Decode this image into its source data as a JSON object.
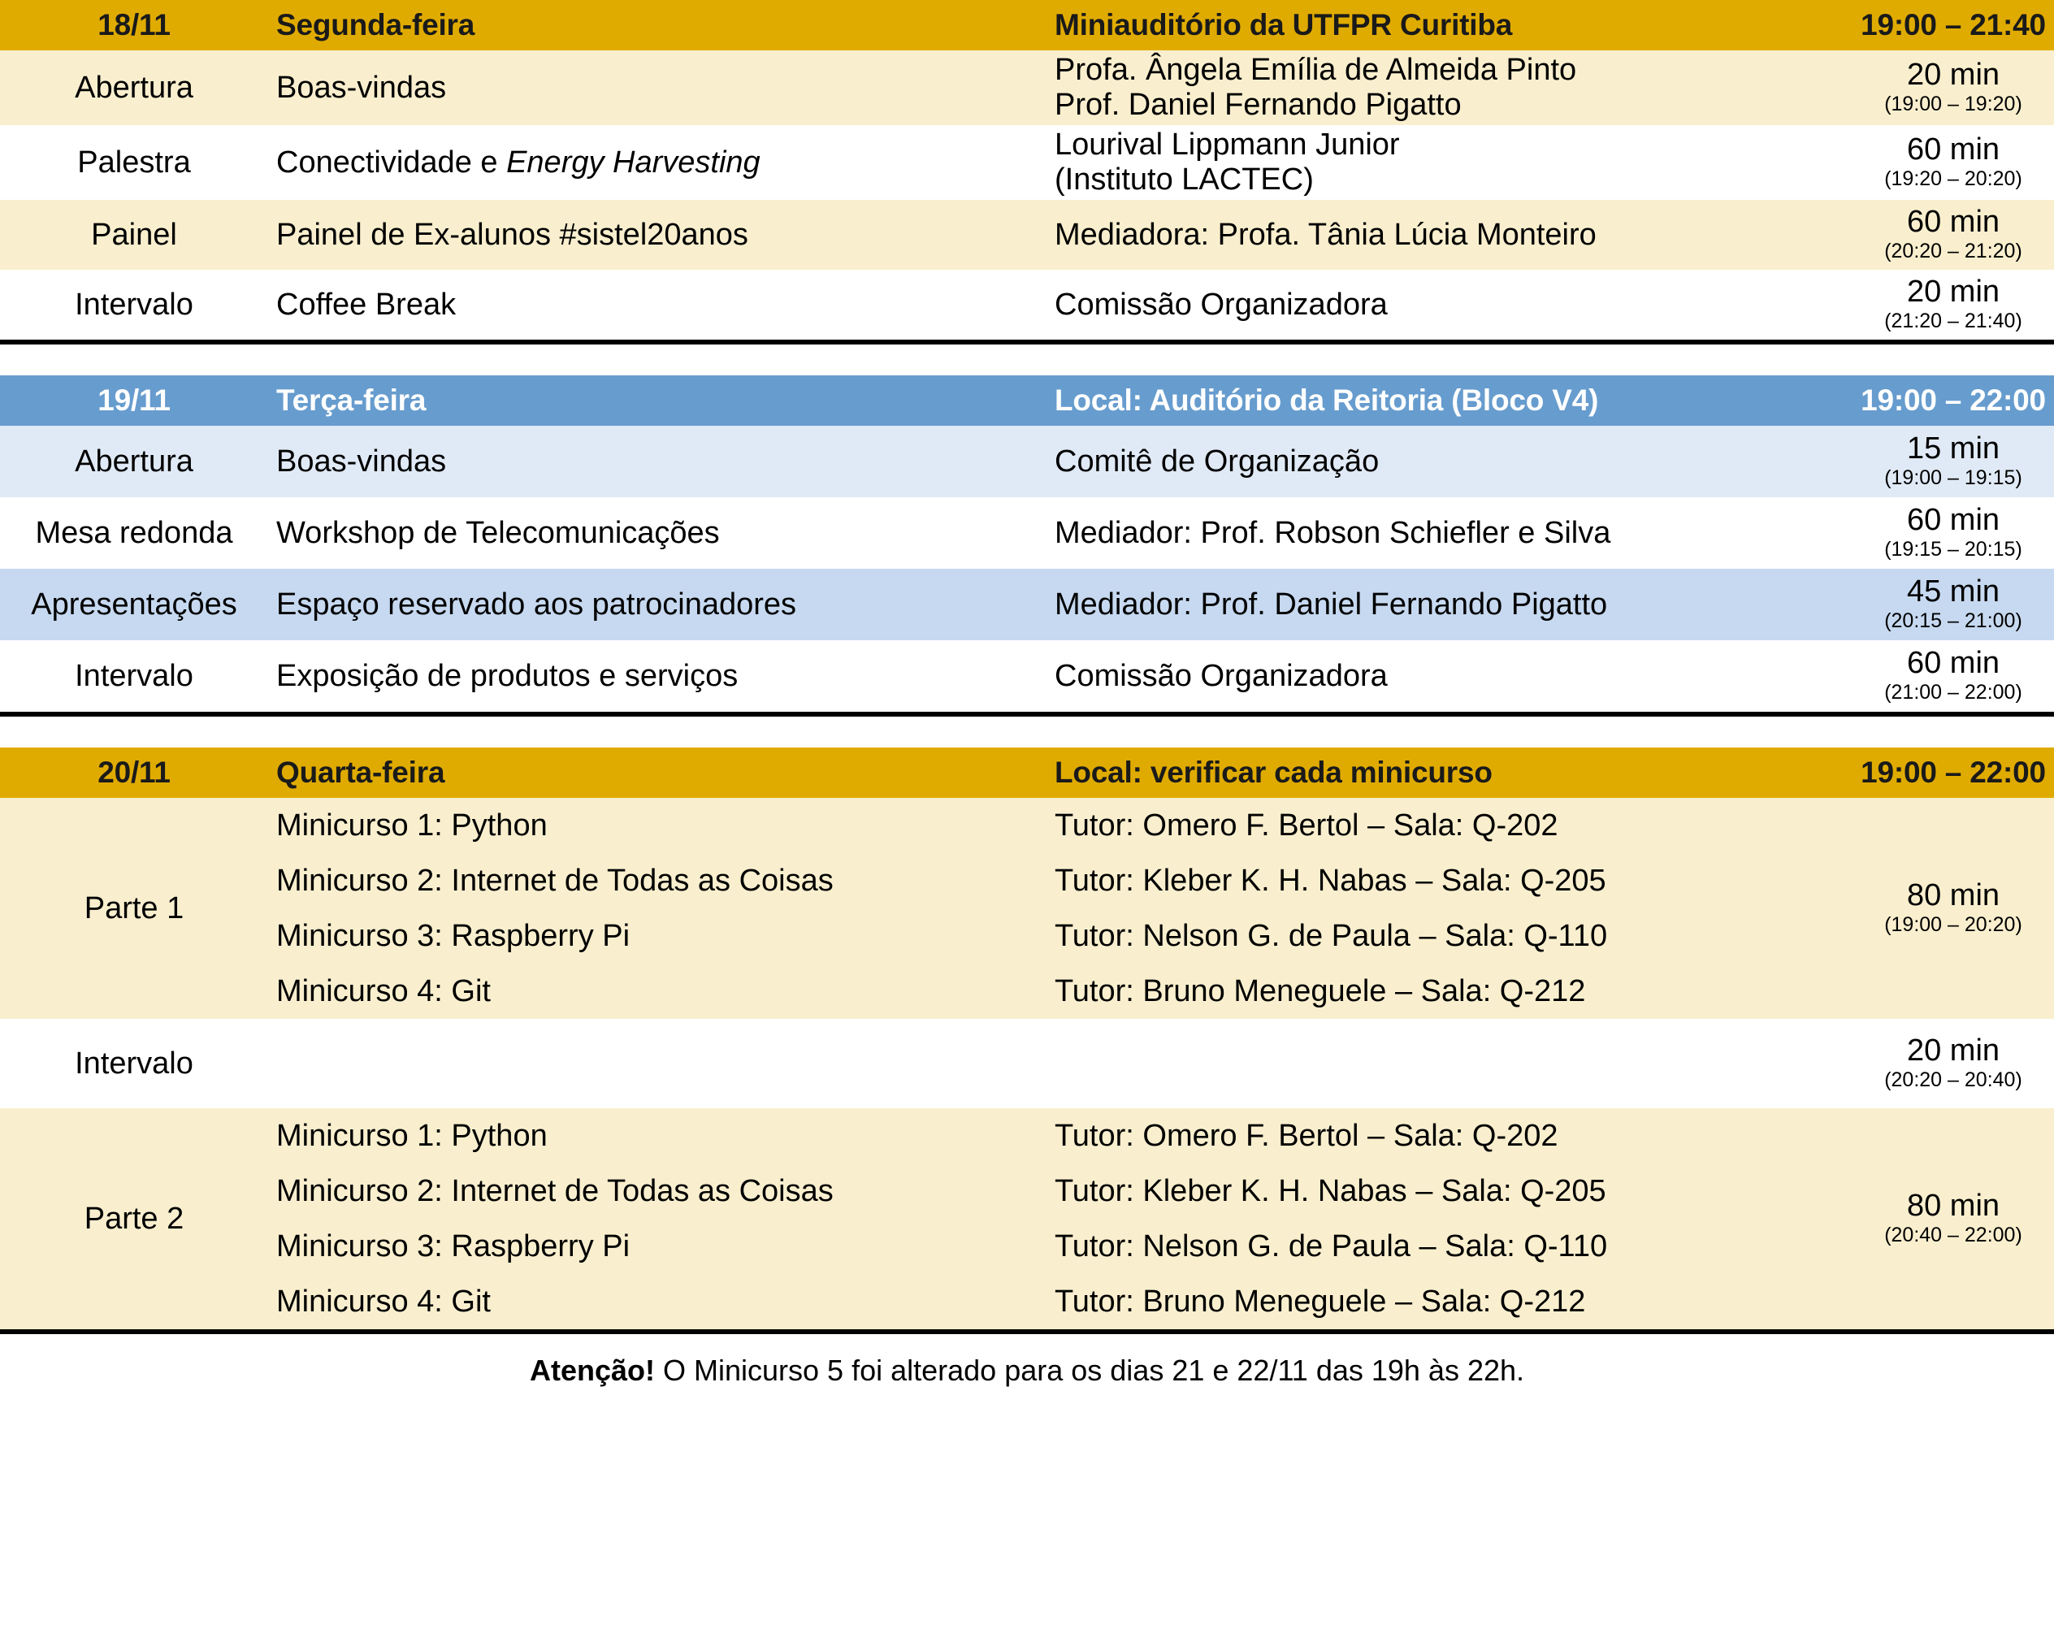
{
  "colors": {
    "gold_header": "#E0AB00",
    "gold_row": "#F9EFCE",
    "blue_header": "#679CCE",
    "blue_row_light": "#E0EAF6",
    "blue_row_medium": "#C6D9F0",
    "rule": "#000000"
  },
  "days": [
    {
      "header": {
        "date": "18/11",
        "weekday": "Segunda-feira",
        "place": "Miniauditório da UTFPR Curitiba",
        "time": "19:00 – 21:40"
      },
      "rows": [
        {
          "type": "Abertura",
          "title": "Boas-vindas",
          "who": [
            "Profa. Ângela Emília de Almeida Pinto",
            "Prof. Daniel Fernando Pigatto"
          ],
          "duration": "20 min",
          "span": "(19:00 – 19:20)"
        },
        {
          "type": "Palestra",
          "title_pre": "Conectividade e ",
          "title_italic": "Energy Harvesting",
          "who": [
            "Lourival Lippmann Junior",
            "(Instituto LACTEC)"
          ],
          "duration": "60 min",
          "span": "(19:20 – 20:20)"
        },
        {
          "type": "Painel",
          "title": "Painel de Ex-alunos #sistel20anos",
          "who": [
            "Mediadora: Profa. Tânia Lúcia Monteiro"
          ],
          "duration": "60 min",
          "span": "(20:20 – 21:20)"
        },
        {
          "type": "Intervalo",
          "title": "Coffee Break",
          "who": [
            "Comissão Organizadora"
          ],
          "duration": "20 min",
          "span": "(21:20 – 21:40)"
        }
      ]
    },
    {
      "header": {
        "date": "19/11",
        "weekday": "Terça-feira",
        "place": "Local: Auditório da Reitoria (Bloco V4)",
        "time": "19:00 – 22:00"
      },
      "rows": [
        {
          "type": "Abertura",
          "title": "Boas-vindas",
          "who": [
            "Comitê de Organização"
          ],
          "duration": "15 min",
          "span": "(19:00 – 19:15)"
        },
        {
          "type": "Mesa redonda",
          "title": "Workshop de Telecomunicações",
          "who": [
            "Mediador: Prof. Robson Schiefler e Silva"
          ],
          "duration": "60 min",
          "span": "(19:15 – 20:15)"
        },
        {
          "type": "Apresentações",
          "title": "Espaço reservado aos patrocinadores",
          "who": [
            "Mediador: Prof. Daniel Fernando Pigatto"
          ],
          "duration": "45 min",
          "span": "(20:15 – 21:00)"
        },
        {
          "type": "Intervalo",
          "title": "Exposição de produtos e serviços",
          "who": [
            "Comissão Organizadora"
          ],
          "duration": "60 min",
          "span": "(21:00 – 22:00)"
        }
      ]
    },
    {
      "header": {
        "date": "20/11",
        "weekday": "Quarta-feira",
        "place": "Local: verificar cada minicurso",
        "time": "19:00 – 22:00"
      },
      "rows": [
        {
          "type": "Parte 1",
          "courses": [
            {
              "title": "Minicurso 1: Python",
              "tutor": "Tutor: Omero F. Bertol – Sala: Q-202"
            },
            {
              "title": "Minicurso 2: Internet de Todas as Coisas",
              "tutor": "Tutor: Kleber K. H. Nabas – Sala: Q-205"
            },
            {
              "title": "Minicurso 3: Raspberry Pi",
              "tutor": "Tutor: Nelson G. de Paula – Sala: Q-110"
            },
            {
              "title": "Minicurso 4: Git",
              "tutor": "Tutor: Bruno Meneguele – Sala: Q-212"
            }
          ],
          "duration": "80 min",
          "span": "(19:00 – 20:20)"
        },
        {
          "type": "Intervalo",
          "title": "",
          "who": [
            ""
          ],
          "duration": "20 min",
          "span": "(20:20 – 20:40)"
        },
        {
          "type": "Parte 2",
          "courses": [
            {
              "title": "Minicurso 1: Python",
              "tutor": "Tutor: Omero F. Bertol – Sala: Q-202"
            },
            {
              "title": "Minicurso 2: Internet de Todas as Coisas",
              "tutor": "Tutor: Kleber K. H. Nabas – Sala: Q-205"
            },
            {
              "title": "Minicurso 3: Raspberry Pi",
              "tutor": "Tutor: Nelson G. de Paula – Sala: Q-110"
            },
            {
              "title": "Minicurso 4: Git",
              "tutor": "Tutor: Bruno Meneguele – Sala: Q-212"
            }
          ],
          "duration": "80 min",
          "span": "(20:40 – 22:00)"
        }
      ]
    }
  ],
  "note": {
    "bold": "Atenção!",
    "text": " O Minicurso 5  foi alterado para os dias 21 e 22/11 das 19h às 22h."
  }
}
